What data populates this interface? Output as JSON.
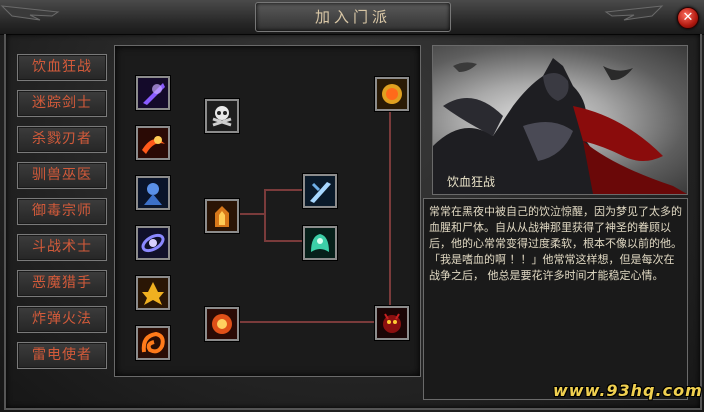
{
  "window": {
    "title": "加入门派"
  },
  "classes": [
    {
      "label": "饮血狂战"
    },
    {
      "label": "迷踪剑士"
    },
    {
      "label": "杀戮刃者"
    },
    {
      "label": "驯兽巫医"
    },
    {
      "label": "御毒宗师"
    },
    {
      "label": "斗战术士"
    },
    {
      "label": "恶魔猎手"
    },
    {
      "label": "炸弹火法"
    },
    {
      "label": "雷电使者"
    }
  ],
  "skills": [
    {
      "name": "purple-slash-icon",
      "color": "#6b3bd6"
    },
    {
      "name": "crimson-cleave-icon",
      "color": "#d33c16"
    },
    {
      "name": "blue-warrior-icon",
      "color": "#3c70c8"
    },
    {
      "name": "arcane-orb-icon",
      "color": "#6d68e0"
    },
    {
      "name": "golden-rage-icon",
      "color": "#d89a1a"
    },
    {
      "name": "fire-swirl-icon",
      "color": "#e0601a"
    },
    {
      "name": "skull-crossbones-icon",
      "color": "#cfcfcf"
    },
    {
      "name": "flame-armor-icon",
      "color": "#e08a1a"
    },
    {
      "name": "fire-fist-icon",
      "color": "#e05018"
    },
    {
      "name": "ice-blade-icon",
      "color": "#6fb0e8"
    },
    {
      "name": "green-spirit-icon",
      "color": "#3cd0a8"
    },
    {
      "name": "golden-shield-icon",
      "color": "#e0a020"
    },
    {
      "name": "red-demon-icon",
      "color": "#c82020"
    }
  ],
  "portrait": {
    "name": "饮血狂战"
  },
  "description": {
    "text": "常常在黑夜中被自己的饮泣惊醒，因为梦见了太多的血腥和尸体。自从从战神那里获得了神圣的眷顾以后，他的心常常变得过度柔软，根本不像以前的他。「我是嗜血的啊 ！！」他常常这样想，但是每次在战争之后，  他总是要花许多时间才能稳定心情。"
  },
  "watermark": "www.93hq.com"
}
